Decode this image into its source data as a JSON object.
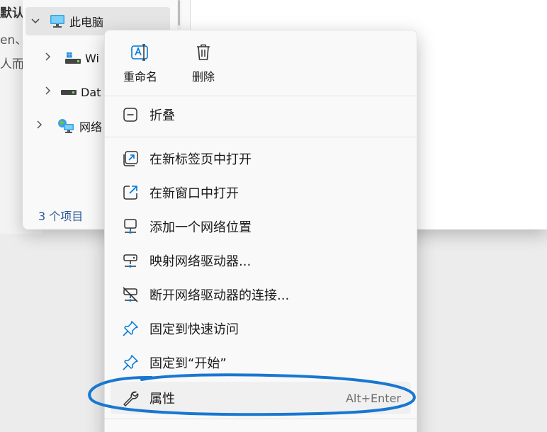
{
  "background_text": {
    "line1": "默认",
    "line2": "en、",
    "line3": "人而混"
  },
  "explorer": {
    "tree": {
      "this_pc": "此电脑",
      "drive_c": "Wi",
      "drive_d": "Dat",
      "network": "网络"
    },
    "status": "3 个项目"
  },
  "menu": {
    "quick_actions": {
      "rename": "重命名",
      "delete": "删除"
    },
    "items": [
      {
        "label": "折叠",
        "icon": "collapse-icon"
      },
      {
        "label": "在新标签页中打开",
        "icon": "new-tab-icon"
      },
      {
        "label": "在新窗口中打开",
        "icon": "open-new-window-icon"
      },
      {
        "label": "添加一个网络位置",
        "icon": "network-location-icon"
      },
      {
        "label": "映射网络驱动器...",
        "icon": "map-drive-icon"
      },
      {
        "label": "断开网络驱动器的连接...",
        "icon": "disconnect-drive-icon"
      },
      {
        "label": "固定到快速访问",
        "icon": "pin-icon"
      },
      {
        "label": "固定到“开始”",
        "icon": "pin-start-icon"
      },
      {
        "label": "属性",
        "icon": "wrench-icon",
        "shortcut": "Alt+Enter"
      }
    ]
  },
  "colors": {
    "accent": "#0078d4",
    "annotation": "#1877d2"
  }
}
